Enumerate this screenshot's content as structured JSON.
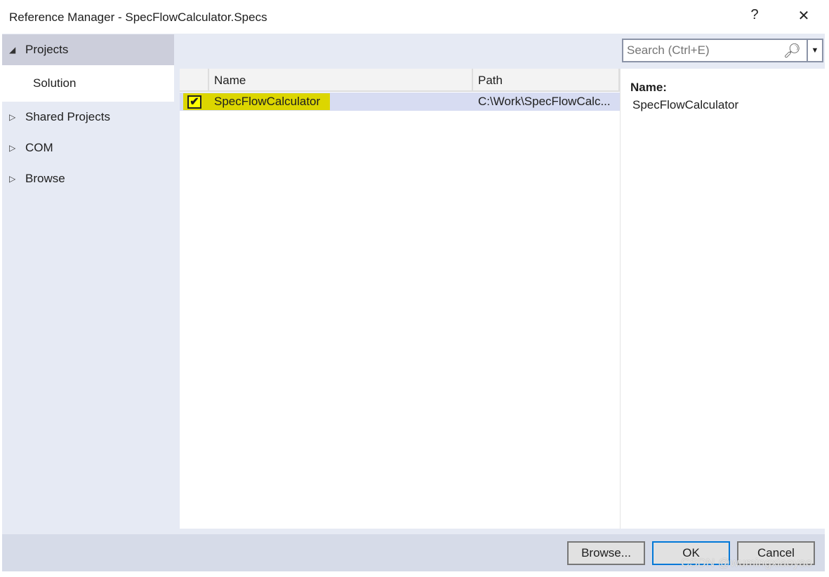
{
  "window": {
    "title": "Reference Manager - SpecFlowCalculator.Specs",
    "help": "?",
    "close": "✕"
  },
  "nav": {
    "items": [
      {
        "label": "Projects",
        "expanded": true,
        "arrow": "◢"
      },
      {
        "label": "Solution",
        "selected": true
      },
      {
        "label": "Shared Projects",
        "arrow": "▷"
      },
      {
        "label": "COM",
        "arrow": "▷"
      },
      {
        "label": "Browse",
        "arrow": "▷"
      }
    ]
  },
  "search": {
    "placeholder": "Search (Ctrl+E)",
    "icon": "search-icon",
    "dropdown": "▼"
  },
  "grid": {
    "columns": [
      "Name",
      "Path"
    ],
    "rows": [
      {
        "checked": true,
        "check": "✔",
        "name": "SpecFlowCalculator",
        "path": "C:\\Work\\SpecFlowCalc..."
      }
    ]
  },
  "details": {
    "label": "Name:",
    "value": "SpecFlowCalculator"
  },
  "footer": {
    "browse": "Browse...",
    "ok": "OK",
    "cancel": "Cancel"
  },
  "watermark": "CSDN @wumingxiaoyao"
}
